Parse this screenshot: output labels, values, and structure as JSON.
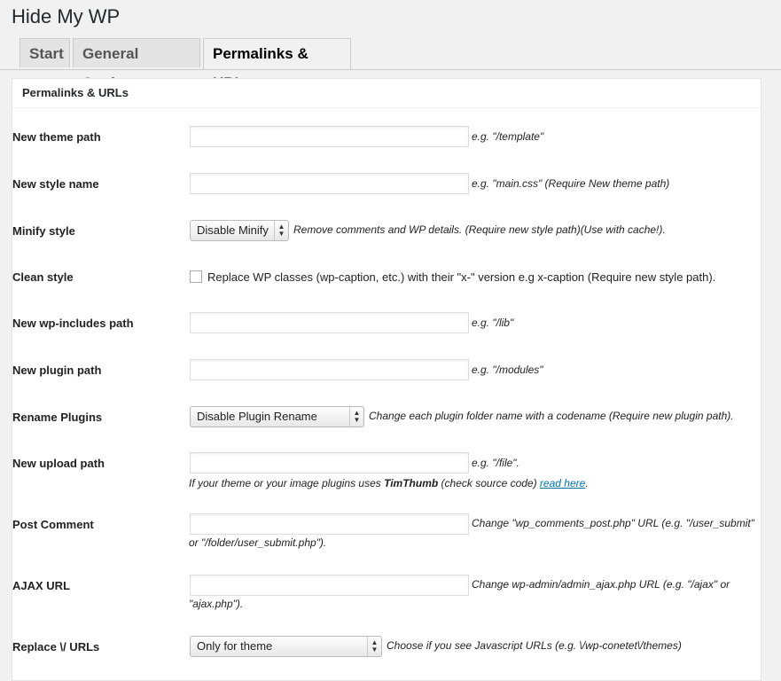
{
  "app": {
    "title": "Hide My WP"
  },
  "tabs": [
    {
      "label": "Start"
    },
    {
      "label": "General Settings"
    },
    {
      "label": "Permalinks & URLs"
    }
  ],
  "panel": {
    "header": "Permalinks & URLs"
  },
  "fields": {
    "theme_path": {
      "label": "New theme path",
      "hint": "e.g. \"/template\"",
      "value": ""
    },
    "style_name": {
      "label": "New style name",
      "hint": "e.g. \"main.css\" (Require New theme path)",
      "value": ""
    },
    "minify_style": {
      "label": "Minify style",
      "selected": "Disable Minify",
      "hint": "Remove comments and WP details. (Require new style path)(Use with cache!)."
    },
    "clean_style": {
      "label": "Clean style",
      "checked": false,
      "text": "Replace WP classes (wp-caption, etc.) with their \"x-\" version e.g x-caption (Require new style path)."
    },
    "includes_path": {
      "label": "New wp-includes path",
      "hint": "e.g. \"/lib\"",
      "value": ""
    },
    "plugin_path": {
      "label": "New plugin path",
      "hint": "e.g. \"/modules\"",
      "value": ""
    },
    "rename_plugins": {
      "label": "Rename Plugins",
      "selected": "Disable Plugin Rename",
      "hint": "Change each plugin folder name with a codename (Require new plugin path)."
    },
    "upload_path": {
      "label": "New upload path",
      "hint": "e.g. \"/file\".",
      "value": "",
      "note_pre": "If your theme or your image plugins uses ",
      "note_bold": "TimThumb",
      "note_mid": " (check source code) ",
      "note_link": "read here",
      "note_post": "."
    },
    "post_comment": {
      "label": "Post Comment",
      "hint_line1": "Change \"wp_comments_post.php\" URL (e.g. \"/user_submit\"",
      "hint_line2": "or \"/folder/user_submit.php\").",
      "value": ""
    },
    "ajax_url": {
      "label": "AJAX URL",
      "hint_line1": "Change wp-admin/admin_ajax.php URL (e.g. \"/ajax\" or",
      "hint_line2": "\"ajax.php\").",
      "value": ""
    },
    "replace_urls": {
      "label": "Replace \\/ URLs",
      "selected": "Only for theme",
      "hint": "Choose if you see Javascript URLs (e.g. \\/wp-conetet\\/themes)"
    }
  }
}
